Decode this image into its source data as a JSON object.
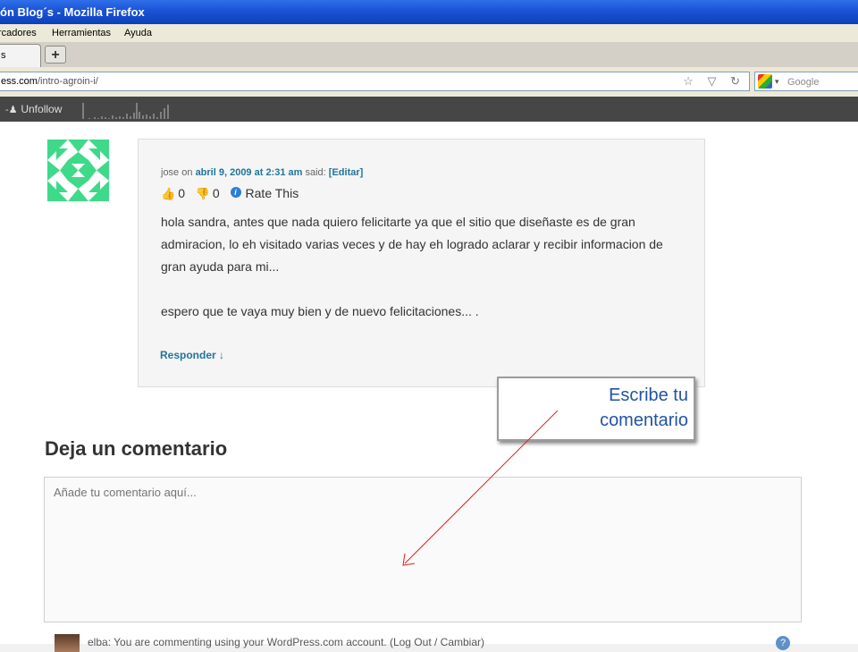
{
  "window": {
    "title": "ón Blog´s - Mozilla Firefox"
  },
  "menu": {
    "items": [
      "rcadores",
      "Herramientas",
      "Ayuda"
    ]
  },
  "tabs": {
    "new_tab_symbol": "+"
  },
  "navbar": {
    "url_host": "ess.com",
    "url_path": "/intro-agroin-i/",
    "url_icons": "☆ ▽ ↻",
    "search_placeholder": "Google",
    "search_dropdown": "▾"
  },
  "adminbar": {
    "unfollow_label": "Unfollow",
    "unfollow_icon": "person-minus-icon"
  },
  "comment": {
    "author": "jose",
    "on_word": "on",
    "date": "abril 9, 2009 at 2:31 am",
    "said_word": "said:",
    "edit_label": "[Editar]",
    "likes": "0",
    "dislikes": "0",
    "rate_label": "Rate This",
    "paragraph1": "hola sandra, antes que nada quiero felicitarte ya que el sitio que diseñaste es de gran admiracion, lo eh visitado varias veces y de hay eh logrado aclarar y recibir informacion de gran ayuda para mi...",
    "paragraph2": "espero que te vaya muy bien y de nuevo felicitaciones... .",
    "reply_label": "Responder ↓"
  },
  "callout": {
    "line1": "Escribe tu",
    "line2": "comentario"
  },
  "leave_comment": {
    "title": "Deja un comentario",
    "placeholder": "Añade tu comentario aquí...",
    "user_line": "elba: You are commenting using your WordPress.com account. (Log Out / Cambiar)",
    "help_symbol": "?"
  },
  "colors": {
    "link": "#21759b",
    "callout_text": "#2153a5",
    "annotation_arrow": "#e02020",
    "avatar_green": "#3fd98a",
    "titlebar_blue": "#1a53d6"
  }
}
